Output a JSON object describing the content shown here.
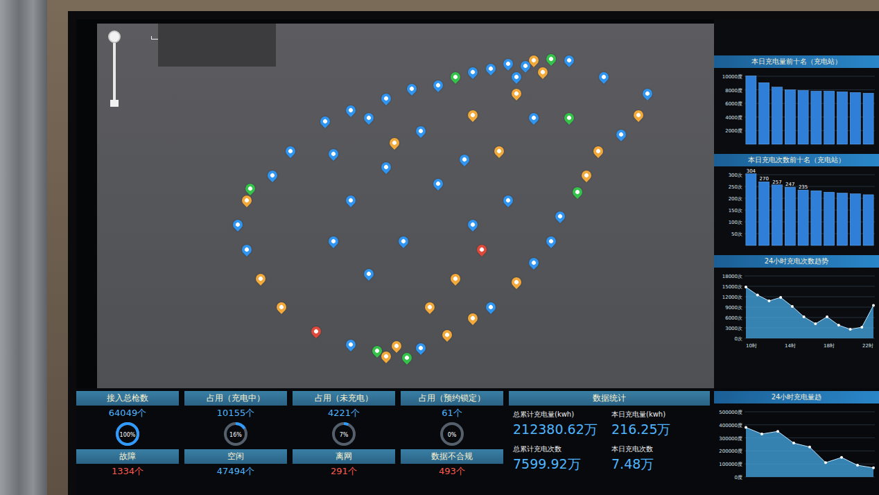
{
  "map": {
    "pins": [
      {
        "lon": 110.35,
        "lat": 20.05,
        "color": "#f2a93b"
      },
      {
        "lon": 110.3,
        "lat": 20.02,
        "color": "#2f95f0"
      },
      {
        "lon": 110.2,
        "lat": 20.03,
        "color": "#2f95f0"
      },
      {
        "lon": 110.1,
        "lat": 20.0,
        "color": "#2f95f0"
      },
      {
        "lon": 110.0,
        "lat": 19.98,
        "color": "#2f95f0"
      },
      {
        "lon": 109.9,
        "lat": 19.95,
        "color": "#35c24a"
      },
      {
        "lon": 109.8,
        "lat": 19.9,
        "color": "#2f95f0"
      },
      {
        "lon": 109.65,
        "lat": 19.88,
        "color": "#2f95f0"
      },
      {
        "lon": 109.5,
        "lat": 19.82,
        "color": "#2f95f0"
      },
      {
        "lon": 110.45,
        "lat": 20.06,
        "color": "#35c24a"
      },
      {
        "lon": 110.55,
        "lat": 20.05,
        "color": "#2f95f0"
      },
      {
        "lon": 110.4,
        "lat": 19.98,
        "color": "#f2a93b"
      },
      {
        "lon": 110.25,
        "lat": 19.95,
        "color": "#2f95f0"
      },
      {
        "lon": 109.3,
        "lat": 19.75,
        "color": "#2f95f0"
      },
      {
        "lon": 109.15,
        "lat": 19.68,
        "color": "#2f95f0"
      },
      {
        "lon": 108.95,
        "lat": 19.5,
        "color": "#2f95f0"
      },
      {
        "lon": 108.85,
        "lat": 19.35,
        "color": "#2f95f0"
      },
      {
        "lon": 108.7,
        "lat": 19.2,
        "color": "#f2a93b"
      },
      {
        "lon": 108.65,
        "lat": 19.05,
        "color": "#2f95f0"
      },
      {
        "lon": 108.7,
        "lat": 18.9,
        "color": "#2f95f0"
      },
      {
        "lon": 108.78,
        "lat": 18.72,
        "color": "#f2a93b"
      },
      {
        "lon": 108.9,
        "lat": 18.55,
        "color": "#f2a93b"
      },
      {
        "lon": 108.72,
        "lat": 19.27,
        "color": "#35c24a"
      },
      {
        "lon": 109.1,
        "lat": 18.4,
        "color": "#e0493a"
      },
      {
        "lon": 109.3,
        "lat": 18.32,
        "color": "#2f95f0"
      },
      {
        "lon": 109.45,
        "lat": 18.28,
        "color": "#35c24a"
      },
      {
        "lon": 109.5,
        "lat": 18.25,
        "color": "#f2a93b"
      },
      {
        "lon": 109.56,
        "lat": 18.31,
        "color": "#f2a93b"
      },
      {
        "lon": 109.62,
        "lat": 18.24,
        "color": "#35c24a"
      },
      {
        "lon": 109.7,
        "lat": 18.3,
        "color": "#2f95f0"
      },
      {
        "lon": 109.85,
        "lat": 18.38,
        "color": "#f2a93b"
      },
      {
        "lon": 110.0,
        "lat": 18.48,
        "color": "#f2a93b"
      },
      {
        "lon": 110.1,
        "lat": 18.55,
        "color": "#2f95f0"
      },
      {
        "lon": 110.25,
        "lat": 18.7,
        "color": "#f2a93b"
      },
      {
        "lon": 110.35,
        "lat": 18.82,
        "color": "#2f95f0"
      },
      {
        "lon": 110.45,
        "lat": 18.95,
        "color": "#2f95f0"
      },
      {
        "lon": 110.5,
        "lat": 19.1,
        "color": "#2f95f0"
      },
      {
        "lon": 110.6,
        "lat": 19.25,
        "color": "#35c24a"
      },
      {
        "lon": 110.65,
        "lat": 19.35,
        "color": "#f2a93b"
      },
      {
        "lon": 110.72,
        "lat": 19.5,
        "color": "#f2a93b"
      },
      {
        "lon": 110.85,
        "lat": 19.6,
        "color": "#2f95f0"
      },
      {
        "lon": 110.95,
        "lat": 19.72,
        "color": "#f2a93b"
      },
      {
        "lon": 111.0,
        "lat": 19.85,
        "color": "#2f95f0"
      },
      {
        "lon": 110.75,
        "lat": 19.95,
        "color": "#2f95f0"
      },
      {
        "lon": 110.55,
        "lat": 19.7,
        "color": "#35c24a"
      },
      {
        "lon": 109.5,
        "lat": 19.4,
        "color": "#2f95f0"
      },
      {
        "lon": 109.8,
        "lat": 19.3,
        "color": "#2f95f0"
      },
      {
        "lon": 110.15,
        "lat": 19.5,
        "color": "#f2a93b"
      },
      {
        "lon": 110.35,
        "lat": 19.7,
        "color": "#2f95f0"
      },
      {
        "lon": 109.3,
        "lat": 19.2,
        "color": "#2f95f0"
      },
      {
        "lon": 109.6,
        "lat": 18.95,
        "color": "#2f95f0"
      },
      {
        "lon": 110.0,
        "lat": 19.05,
        "color": "#2f95f0"
      },
      {
        "lon": 109.9,
        "lat": 18.72,
        "color": "#f2a93b"
      },
      {
        "lon": 109.4,
        "lat": 18.75,
        "color": "#2f95f0"
      },
      {
        "lon": 109.2,
        "lat": 18.95,
        "color": "#2f95f0"
      },
      {
        "lon": 110.2,
        "lat": 19.2,
        "color": "#2f95f0"
      },
      {
        "lon": 110.0,
        "lat": 19.72,
        "color": "#f2a93b"
      },
      {
        "lon": 109.7,
        "lat": 19.62,
        "color": "#2f95f0"
      },
      {
        "lon": 109.55,
        "lat": 19.55,
        "color": "#f2a93b"
      },
      {
        "lon": 109.95,
        "lat": 19.45,
        "color": "#2f95f0"
      },
      {
        "lon": 110.05,
        "lat": 18.9,
        "color": "#e0493a"
      },
      {
        "lon": 109.75,
        "lat": 18.55,
        "color": "#f2a93b"
      },
      {
        "lon": 109.2,
        "lat": 19.48,
        "color": "#2f95f0"
      },
      {
        "lon": 110.25,
        "lat": 19.85,
        "color": "#f2a93b"
      },
      {
        "lon": 109.4,
        "lat": 19.7,
        "color": "#2f95f0"
      }
    ]
  },
  "side_charts": [
    {
      "kind": "bar",
      "title": "本日充电量前十名（充电站）",
      "ticks": [
        "10000度",
        "8000度",
        "6000度",
        "4000度",
        "2000度"
      ],
      "values": [
        10058,
        9056,
        8400,
        8000,
        7900,
        7800,
        7800,
        7700,
        7600,
        7500
      ],
      "value_labels": [],
      "x_labels": []
    },
    {
      "kind": "bar",
      "title": "本日充电次数前十名（充电站）",
      "ticks": [
        "300次",
        "250次",
        "200次",
        "150次",
        "100次",
        "50次"
      ],
      "values": [
        304,
        270,
        257,
        247,
        235,
        232,
        226,
        222,
        219,
        215
      ],
      "value_labels": [
        "304",
        "270",
        "257",
        "247",
        "235"
      ],
      "x_labels": []
    },
    {
      "kind": "area",
      "title": "24小时充电次数趋势",
      "ticks": [
        "18000次",
        "15000次",
        "12000次",
        "9000次",
        "6000次",
        "3000次",
        "0次"
      ],
      "values": [
        14800,
        12500,
        10800,
        11800,
        9200,
        6200,
        4200,
        6200,
        3800,
        2600,
        3200,
        9500
      ],
      "value_labels": [],
      "x_labels": [
        "10时",
        "14时",
        "18时",
        "22时"
      ]
    }
  ],
  "bottom_chart": {
    "kind": "area",
    "title": "24小时充电量趋",
    "ticks": [
      "500000度",
      "400000度",
      "300000度",
      "200000度",
      "100000度",
      "0度"
    ],
    "values": [
      380000,
      330000,
      350000,
      260000,
      230000,
      110000,
      150000,
      90000,
      70000
    ],
    "value_labels": [],
    "x_labels": []
  },
  "cards": [
    {
      "label": "接入总枪数",
      "value": "64049个",
      "percent": "100%",
      "level": 1
    },
    {
      "label": "占用（充电中）",
      "value": "10155个",
      "percent": "16%",
      "level": 0.16
    },
    {
      "label": "占用（未充电）",
      "value": "4221个",
      "percent": "7%",
      "level": 0.07
    },
    {
      "label": "占用（预约锁定）",
      "value": "61个",
      "percent": "0%",
      "level": 0
    }
  ],
  "status": [
    {
      "label": "故障",
      "value": "1334个",
      "alert": true
    },
    {
      "label": "空闲",
      "value": "47494个",
      "alert": false
    },
    {
      "label": "离网",
      "value": "291个",
      "alert": true
    },
    {
      "label": "数据不合规",
      "value": "493个",
      "alert": true
    }
  ],
  "summary": {
    "title": "数据统计",
    "items": [
      {
        "label": "总累计充电量(kwh)",
        "value": "212380.62万"
      },
      {
        "label": "本日充电量(kwh)",
        "value": "216.25万"
      },
      {
        "label": "总累计充电次数",
        "value": "7599.92万"
      },
      {
        "label": "本日充电次数",
        "value": "7.48万"
      }
    ]
  }
}
